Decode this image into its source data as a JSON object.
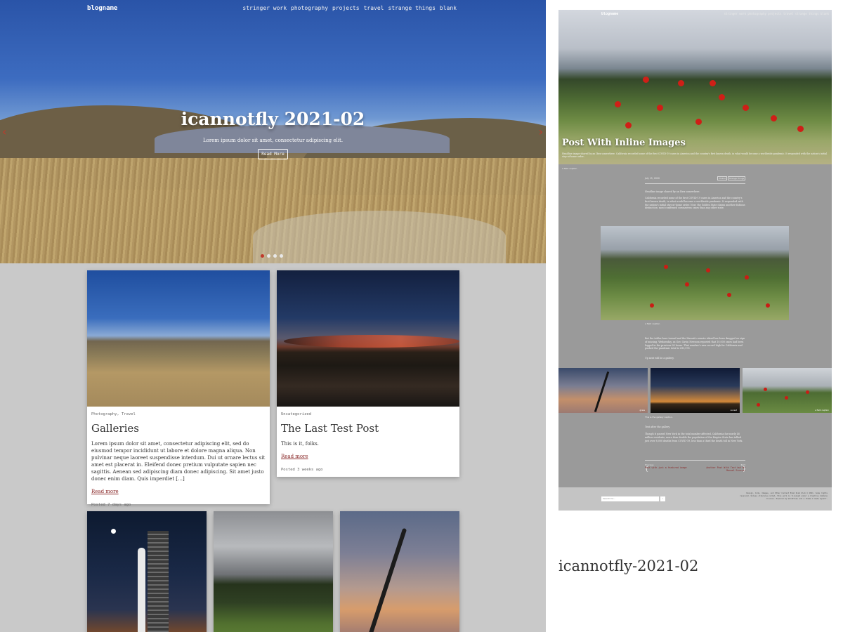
{
  "site": {
    "brand": "blogname",
    "menu": [
      "stringer work",
      "photography",
      "projects",
      "travel",
      "strange things",
      "blank"
    ]
  },
  "hero": {
    "title": "icannotfly 2021-02",
    "subtitle": "Lorem ipsum dolor sit amet, consectetur adipiscing elit.",
    "button_label": "Read More",
    "arrow_left": "‹",
    "arrow_right": "›",
    "slides": 4,
    "active_slide": 1
  },
  "posts": [
    {
      "category": "Photography, Travel",
      "title": "Galleries",
      "excerpt": "Lorem ipsum dolor sit amet, consectetur adipiscing elit, sed do eiusmod tempor incididunt ut labore et dolore magna aliqua. Non pulvinar neque laoreet suspendisse interdum. Dui ut ornare lectus sit amet est placerat in. Eleifend donec pretium vulputate sapien nec sagittis. Aenean sed adipiscing diam donec adipiscing. Sit amet justo donec enim diam. Quis imperdiet […]",
      "read_more": "Read more",
      "posted": "Posted 7 days ago"
    },
    {
      "category": "Uncategorized",
      "title": "The Last Test Post",
      "excerpt": "This is it, folks.",
      "read_more": "Read more",
      "posted": "Posted 3 weeks ago"
    }
  ],
  "preview": {
    "brand": "blogname",
    "menu": "stringer work  photography  projects  travel  strange things  blank",
    "title": "Post With Inline Images",
    "excerpt": "Headline image shared by an Ibex somewhere. California recorded some of the first COVID-19 cases in America and the country's first known death, in what would become a worldwide pandemic. It responded with the nation's initial stay-at-home order...",
    "hero_caption": "a field caption",
    "date": "July 15, 2020",
    "tags": [
      "Photos",
      "Strange Things"
    ],
    "paragraphs": [
      "Headline image shared by an Ibex somewhere.",
      "California recorded some of the first COVID-19 cases in America and the country's first known death, in what would become a worldwide pandemic. It responded with the nation's initial stay-at-home order. Now, the Golden State claims another dubious distinction: most confirmed coronavirus cases than any other state."
    ],
    "inline_caption": "a field caption",
    "paragraphs2": [
      "But the tables have turned and the Hawaii's remote island has been dragged on sign of missing. Wednesday, as Gov. Gavin Newsom reported that 10,000 cases had been logged in the previous 24 hours. That number's new record high for California and pushed the pandemic total to 413,576.",
      "Up next will be a gallery."
    ],
    "gallery_captions": [
      "grass",
      "sunset",
      "a field caption"
    ],
    "gallery_caption": "This is the gallery caption.",
    "paragraphs3": [
      "Text after the gallery.",
      "Though it passed New York in the total number affected, California far nearly 40 million residents, more than double the population of the Empire State has tallied just over 8,000 deaths from COVID-19, less than a third the death toll in New York."
    ],
    "nav": {
      "prev_label": "Previous",
      "prev_title": "Post with just a featured image",
      "next_label": "Next",
      "next_title": "Another Post With Text but No Manual Excerpt"
    },
    "search_placeholder": "Search for...",
    "search_button": "›",
    "footer_text": "Design, Code, Images, and Other Content Blah blah blah © 2021. Some rights reserved. Unless otherwise noted, this work is licensed under a Creative Commons license. Powered by WordPress and a theme I made myself."
  },
  "caption": "icannotfly-2021-02"
}
